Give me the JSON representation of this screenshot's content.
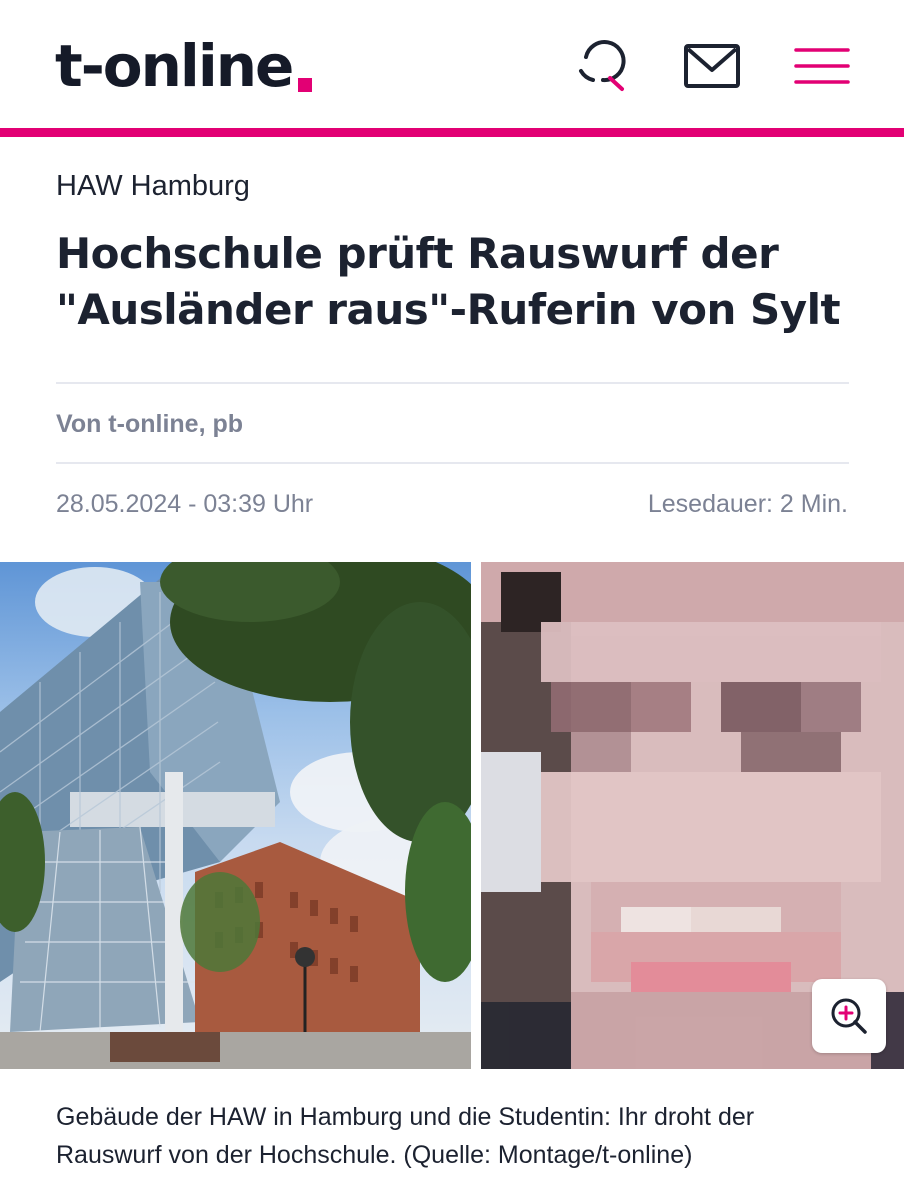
{
  "header": {
    "logo_text": "t-online",
    "brand_color": "#e20074",
    "icons": [
      "search-icon",
      "mail-icon",
      "menu-icon"
    ]
  },
  "article": {
    "kicker": "HAW Hamburg",
    "headline": "Hochschule prüft Rauswurf der \"Ausländer raus\"-Ruferin von Sylt",
    "author": "Von t-online, pb",
    "date": "28.05.2024 - 03:39 Uhr",
    "read_time": "Lesedauer: 2 Min."
  },
  "image": {
    "caption": "Gebäude der HAW in Hamburg und die Studentin: Ihr droht der Rauswurf von der Hochschule. (Quelle: Montage/t-online)",
    "zoom_icon": "zoom-in-icon"
  }
}
